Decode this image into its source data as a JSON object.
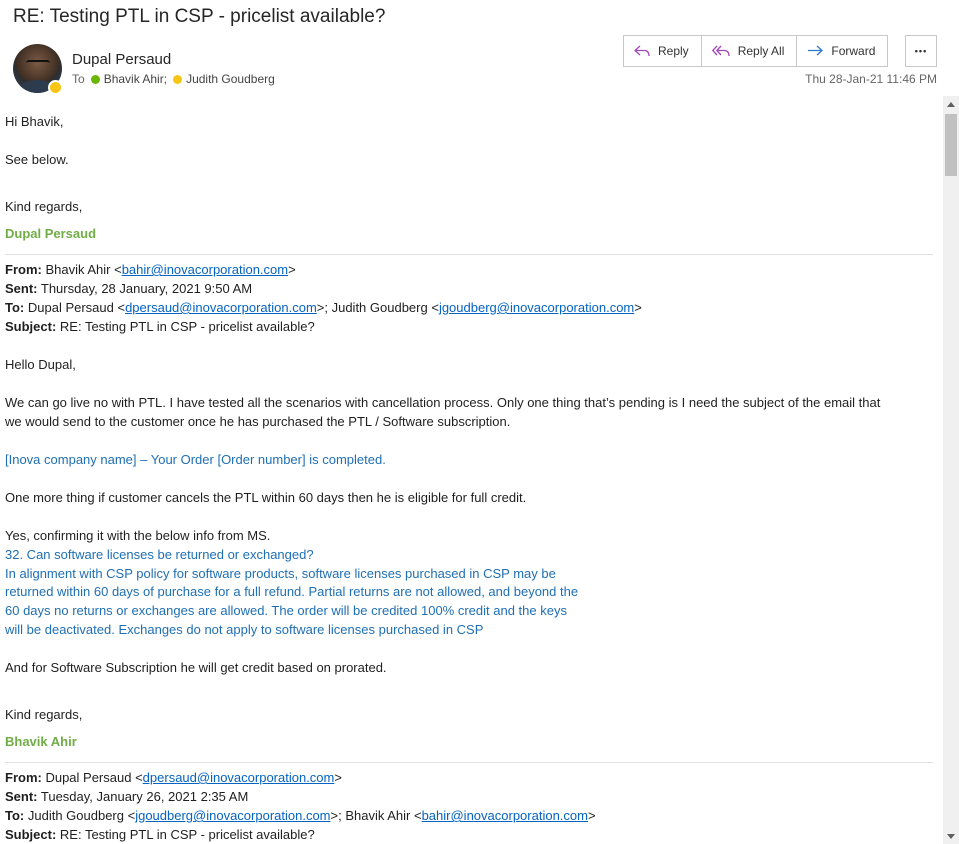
{
  "header": {
    "subject": "RE: Testing PTL in CSP - pricelist available?",
    "sender": "Dupal Persaud",
    "to_label": "To",
    "recipients": [
      "Bhavik Ahir;",
      "Judith Goudberg"
    ],
    "date": "Thu 28-Jan-21 11:46 PM"
  },
  "actions": {
    "reply": "Reply",
    "reply_all": "Reply All",
    "forward": "Forward",
    "more": "•••"
  },
  "colors": {
    "signature": "#70ad47",
    "link": "#0563c1",
    "quote": "#1f6fb4",
    "presence_available": "#6bb700",
    "presence_away": "#f8c515"
  },
  "icons": [
    "reply-icon",
    "reply-all-icon",
    "forward-icon",
    "more-icon",
    "presence-icon"
  ],
  "body": {
    "greeting": "Hi Bhavik,",
    "see_below": "See below.",
    "kind_regards": "Kind regards,",
    "signature": "Dupal Persaud",
    "msg1": {
      "from_label": "From:",
      "from_name": " Bhavik Ahir <",
      "from_email": "bahir@inovacorporation.com",
      "from_close": ">",
      "sent_label": "Sent:",
      "sent": " Thursday, 28 January, 2021 9:50 AM",
      "to_label": "To:",
      "to_name1": " Dupal Persaud <",
      "to_email1": "dpersaud@inovacorporation.com",
      "to_sep": ">; Judith Goudberg <",
      "to_email2": "jgoudberg@inovacorporation.com",
      "to_close": ">",
      "subject_label": "Subject:",
      "subject": " RE: Testing PTL in CSP - pricelist available?",
      "hello": "Hello Dupal,",
      "p1_line1": "We can go live no with PTL. I have tested all the scenarios with cancellation process. Only one thing that’s pending is I need the subject of the email that",
      "p1_line2": "we would send to the customer once he has purchased the PTL / Software subscription.",
      "order_subject": "[Inova company name] – Your Order [Order number] is completed.",
      "p2": "One more thing if customer cancels the PTL within 60 days then he is eligible for full credit.",
      "p3": "Yes, confirming it with the below info from MS.",
      "q1": "32. Can software licenses be returned or exchanged?",
      "q2": "In alignment with CSP policy for software products, software licenses purchased in CSP may be",
      "q3": "returned within 60 days of purchase for a full refund. Partial returns are not allowed, and beyond the",
      "q4": "60 days no returns or exchanges are allowed. The order will be credited 100% credit and the keys",
      "q5": "will be deactivated. Exchanges do not apply to software licenses purchased in CSP",
      "p4": "And for Software Subscription he will get credit based on prorated.",
      "kind_regards": "Kind regards,",
      "signature": "Bhavik Ahir"
    },
    "msg2": {
      "from_label": "From:",
      "from_name": " Dupal Persaud <",
      "from_email": "dpersaud@inovacorporation.com",
      "from_close": ">",
      "sent_label": "Sent:",
      "sent": " Tuesday, January 26, 2021 2:35 AM",
      "to_label": "To:",
      "to_name1": " Judith Goudberg <",
      "to_email1": "jgoudberg@inovacorporation.com",
      "to_sep": ">; Bhavik Ahir <",
      "to_email2": "bahir@inovacorporation.com",
      "to_close": ">",
      "subject_label": "Subject:",
      "subject": " RE: Testing PTL in CSP - pricelist available?"
    }
  }
}
